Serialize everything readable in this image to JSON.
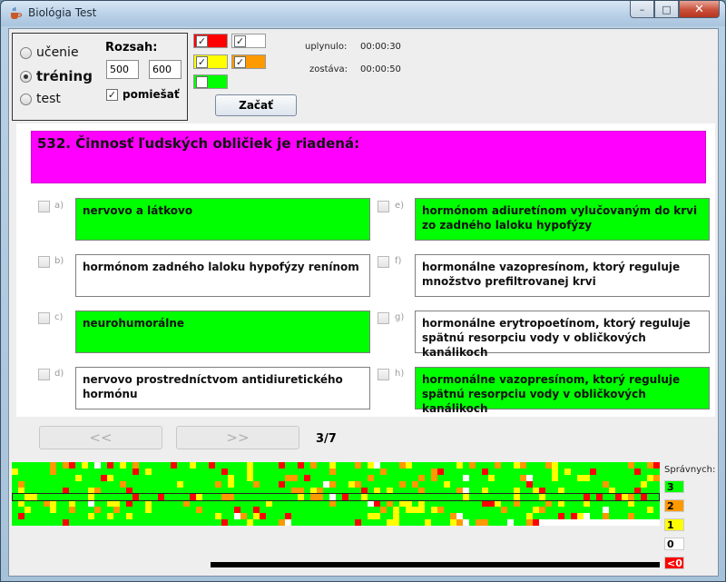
{
  "window": {
    "title": "Biológia Test",
    "controls": {
      "minimize": "–",
      "maximize": "□",
      "close": "✕"
    }
  },
  "mode": {
    "options": [
      {
        "label": "učenie",
        "selected": false
      },
      {
        "label": "tréning",
        "selected": true
      },
      {
        "label": "test",
        "selected": false
      }
    ]
  },
  "range": {
    "label": "Rozsah:",
    "from": "500",
    "to": "600",
    "shuffle_label": "pomiešať",
    "shuffle_checked": true
  },
  "filters": [
    {
      "color": "#ff0000",
      "checked": true
    },
    {
      "color": "#ffffff",
      "checked": true
    },
    {
      "color": "#ffff00",
      "checked": true
    },
    {
      "color": "#ff9900",
      "checked": true
    },
    {
      "color": "#00ff00",
      "checked": false
    }
  ],
  "start_button": "Začať",
  "timer": {
    "elapsed_label": "uplynulo:",
    "elapsed": "00:00:30",
    "remaining_label": "zostáva:",
    "remaining": "00:00:50"
  },
  "question": {
    "text": "532. Činnosť ľudských obličiek je riadená:",
    "background": "#ff00ff",
    "answers": [
      {
        "letter": "a)",
        "text": "nervovo a látkovo",
        "correct": true
      },
      {
        "letter": "b)",
        "text": "hormónom zadného laloku hypofýzy renínom",
        "correct": false
      },
      {
        "letter": "c)",
        "text": "neurohumorálne",
        "correct": true
      },
      {
        "letter": "d)",
        "text": "nervovo prostredníctvom antidiuretického hormónu",
        "correct": false
      },
      {
        "letter": "e)",
        "text": "hormónom adiuretínom vylučovaným do krvi zo zadného laloku hypofýzy",
        "correct": true
      },
      {
        "letter": "f)",
        "text": "hormonálne vazopresínom, ktorý reguluje množstvo prefiltrovanej krvi",
        "correct": false
      },
      {
        "letter": "g)",
        "text": "hormonálne erytropoetínom, ktorý reguluje spätnú resorpciu vody v obličkových kanálikoch",
        "correct": false
      },
      {
        "letter": "h)",
        "text": "hormonálne vazopresínom, ktorý reguluje spätnú resorpciu vody v obličkových kanálikoch",
        "correct": true
      }
    ]
  },
  "navigation": {
    "prev": "<<",
    "next": ">>",
    "counter": "3/7"
  },
  "stats": {
    "legend_title": "Správnych:",
    "legend": [
      {
        "label": "3",
        "color": "#00ff00"
      },
      {
        "label": "2",
        "color": "#ff9900"
      },
      {
        "label": "1",
        "color": "#ffff00"
      },
      {
        "label": "0",
        "color": "#ffffff"
      },
      {
        "label": "<0",
        "color": "#ff0000"
      }
    ]
  }
}
